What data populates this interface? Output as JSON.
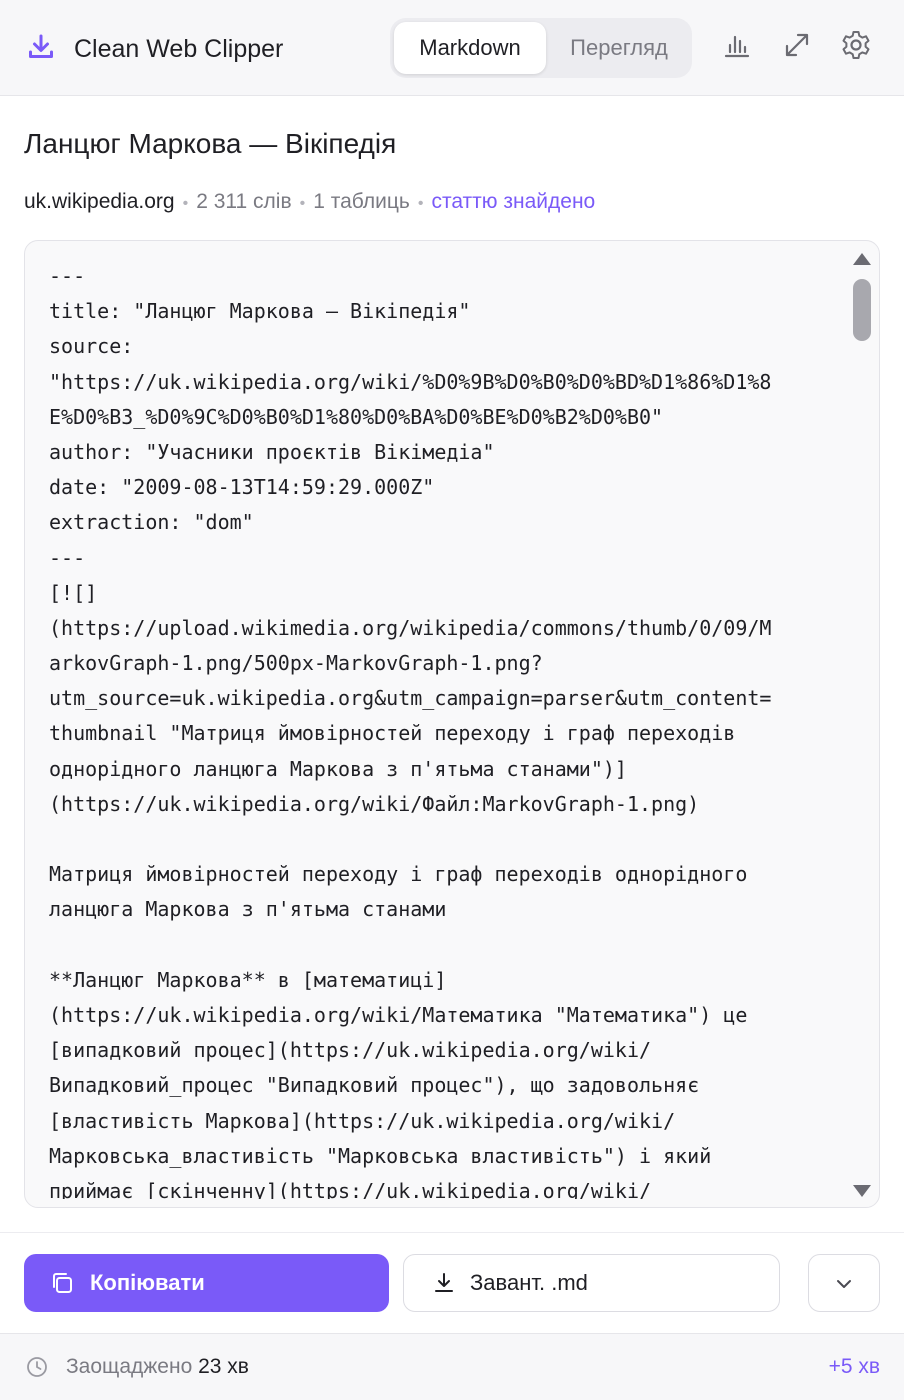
{
  "app": {
    "title": "Clean Web Clipper"
  },
  "view_toggle": {
    "markdown_label": "Markdown",
    "preview_label": "Перегляд",
    "selected": "Markdown"
  },
  "header_icons": [
    "chart-icon",
    "expand-icon",
    "gear-icon"
  ],
  "article": {
    "title": "Ланцюг Маркова — Вікіпедія",
    "domain": "uk.wikipedia.org",
    "words": "2 311 слів",
    "tables": "1 таблиць",
    "status": "статтю знайдено"
  },
  "markdown_lines": [
    "---",
    "title: \"Ланцюг Маркова — Вікіпедія\"",
    "source:",
    "\"https://uk.wikipedia.org/wiki/%D0%9B%D0%B0%D0%BD%D1%86%D1%8",
    "E%D0%B3_%D0%9C%D0%B0%D1%80%D0%BA%D0%BE%D0%B2%D0%B0\"",
    "author: \"Учасники проєктів Вікімедіа\"",
    "date: \"2009-08-13T14:59:29.000Z\"",
    "extraction: \"dom\"",
    "---",
    "[![]",
    "(https://upload.wikimedia.org/wikipedia/commons/thumb/0/09/M",
    "arkovGraph-1.png/500px-MarkovGraph-1.png?",
    "utm_source=uk.wikipedia.org&utm_campaign=parser&utm_content=",
    "thumbnail \"Матриця ймовірностей переходу і граф переходів",
    "однорідного ланцюга Маркова з п'ятьма станами\")]",
    "(https://uk.wikipedia.org/wiki/Файл:MarkovGraph-1.png)",
    "",
    "Матриця ймовірностей переходу і граф переходів однорідного",
    "ланцюга Маркова з п'ятьма станами",
    "",
    "**Ланцюг Маркова** в [математиці]",
    "(https://uk.wikipedia.org/wiki/Математика \"Математика\") це",
    "[випадковий процес](https://uk.wikipedia.org/wiki/",
    "Випадковий_процес \"Випадковий процес\"), що задовольняє",
    "[властивість Маркова](https://uk.wikipedia.org/wiki/",
    "Марковська_властивість \"Марковська властивість\") і який",
    "приймає [скінченну](https://uk.wikipedia.org/wiki/"
  ],
  "actions": {
    "copy_label": "Копіювати",
    "download_label": "Завант. .md"
  },
  "status": {
    "saved_prefix": "Заощаджено",
    "saved_value": "23 хв",
    "delta": "+5 хв"
  },
  "colors": {
    "accent": "#7a5af8",
    "text": "#1f1f24",
    "muted": "#7a7a82"
  }
}
